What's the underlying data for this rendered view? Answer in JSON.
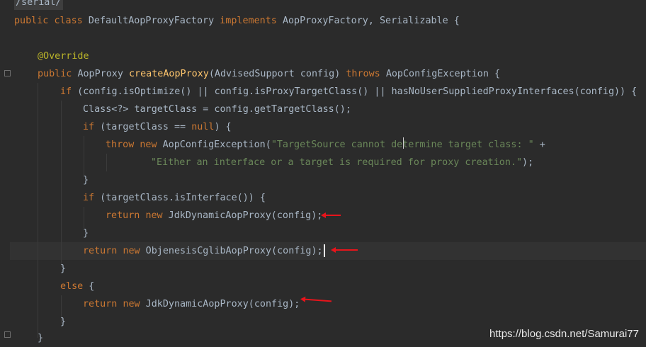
{
  "header_comment": "/serial/",
  "class_decl": {
    "kw_public": "public",
    "kw_class": "class",
    "name": "DefaultAopProxyFactory",
    "kw_implements": "implements",
    "ifaces": "AopProxyFactory, Serializable {"
  },
  "annotation": "@Override",
  "method_decl": {
    "kw_public": "public",
    "ret": "AopProxy",
    "name": "createAopProxy",
    "params": "(AdvisedSupport config)",
    "kw_throws": "throws",
    "exc": "AopConfigException {"
  },
  "lines": {
    "if1_kw": "if",
    "if1_rest": " (config.isOptimize() || config.isProxyTargetClass() || hasNoUserSuppliedProxyInterfaces(config)) {",
    "assign": "Class<?> targetClass = config.getTargetClass();",
    "if2_kw": "if",
    "if2_a": " (targetClass == ",
    "if2_null": "null",
    "if2_b": ") {",
    "throw_kw": "throw",
    "throw_new": "new",
    "throw_cls": " AopConfigException(",
    "throw_str1": "\"TargetSource cannot determine target class: \"",
    "throw_plus": " +",
    "throw_str2": "\"Either an interface or a target is required for proxy creation.\"",
    "throw_end": ");",
    "close1": "}",
    "if3_kw": "if",
    "if3_rest": " (targetClass.isInterface()) {",
    "ret1_kw": "return",
    "ret1_new": "new",
    "ret1_rest": " JdkDynamicAopProxy(config);",
    "close2": "}",
    "ret2_kw": "return",
    "ret2_new": "new",
    "ret2_rest": " ObjenesisCglibAopProxy(config);",
    "close3": "}",
    "else_kw": "else",
    "else_rest": " {",
    "ret3_kw": "return",
    "ret3_new": "new",
    "ret3_rest": " JdkDynamicAopProxy(config);",
    "close4": "}",
    "close5": "}"
  },
  "watermark": "https://blog.csdn.net/Samurai77"
}
